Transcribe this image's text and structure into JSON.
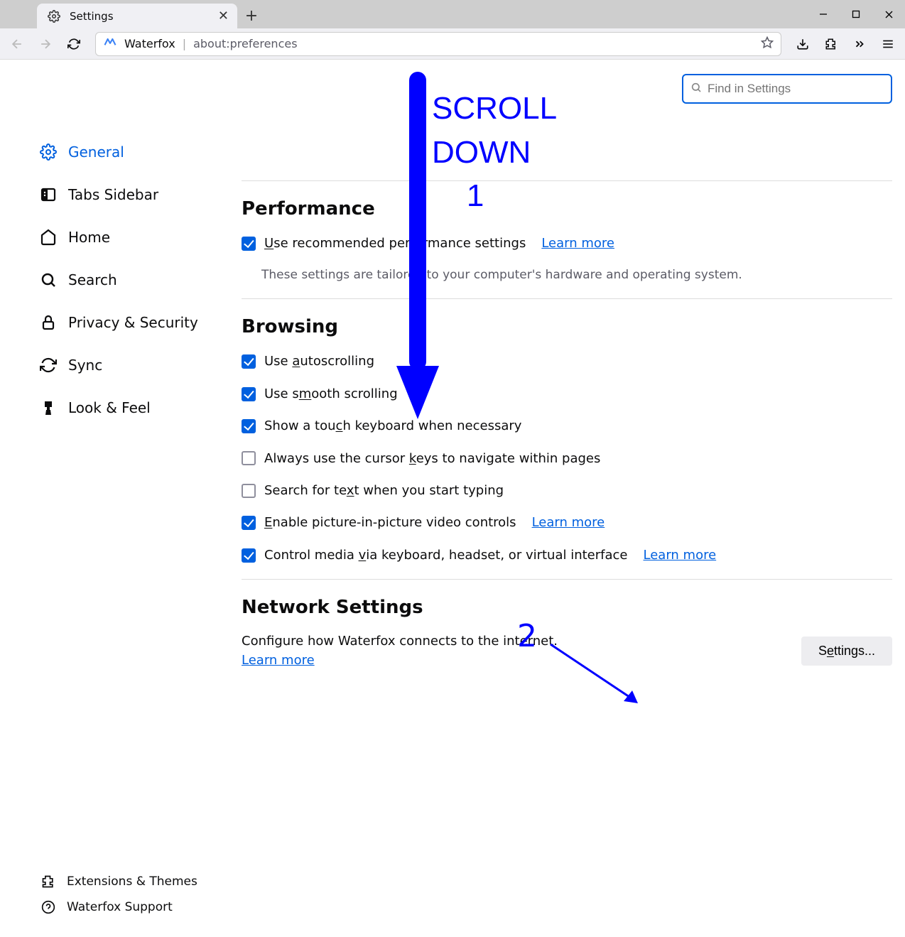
{
  "window": {
    "tab_title": "Settings",
    "new_tab_tooltip": "+"
  },
  "urlbar": {
    "brand": "Waterfox",
    "url": "about:preferences"
  },
  "sidebar": {
    "items": [
      {
        "label": "General"
      },
      {
        "label": "Tabs Sidebar"
      },
      {
        "label": "Home"
      },
      {
        "label": "Search"
      },
      {
        "label": "Privacy & Security"
      },
      {
        "label": "Sync"
      },
      {
        "label": "Look & Feel"
      }
    ],
    "footer": [
      {
        "label": "Extensions & Themes"
      },
      {
        "label": "Waterfox Support"
      }
    ]
  },
  "search": {
    "placeholder": "Find in Settings"
  },
  "sections": {
    "performance": {
      "title": "Performance",
      "opt1_pre": "U",
      "opt1_mid": "se recommended performance settings",
      "learn_more": "Learn more",
      "note": "These settings are tailored to your computer's hardware and operating system."
    },
    "browsing": {
      "title": "Browsing",
      "opts": [
        {
          "checked": true,
          "pre": "Use ",
          "u": "a",
          "post": "utoscrolling"
        },
        {
          "checked": true,
          "pre": "Use s",
          "u": "m",
          "post": "ooth scrolling"
        },
        {
          "checked": true,
          "pre": "Show a tou",
          "u": "c",
          "post": "h keyboard when necessary"
        },
        {
          "checked": false,
          "pre": "Always use the cursor ",
          "u": "k",
          "post": "eys to navigate within pages"
        },
        {
          "checked": false,
          "pre": "Search for te",
          "u": "x",
          "post": "t when you start typing"
        },
        {
          "checked": true,
          "pre": "",
          "u": "E",
          "post": "nable picture-in-picture video controls",
          "link": "Learn more"
        },
        {
          "checked": true,
          "pre": "Control media ",
          "u": "v",
          "post": "ia keyboard, headset, or virtual interface",
          "link": "Learn more"
        }
      ]
    },
    "network": {
      "title": "Network Settings",
      "desc": "Configure how Waterfox connects to the internet.",
      "learn_more": "Learn more",
      "button_pre": "S",
      "button_u": "e",
      "button_post": "ttings..."
    }
  },
  "annotations": {
    "scroll_text": "SCROLL\nDOWN\n     1",
    "two": "2"
  }
}
